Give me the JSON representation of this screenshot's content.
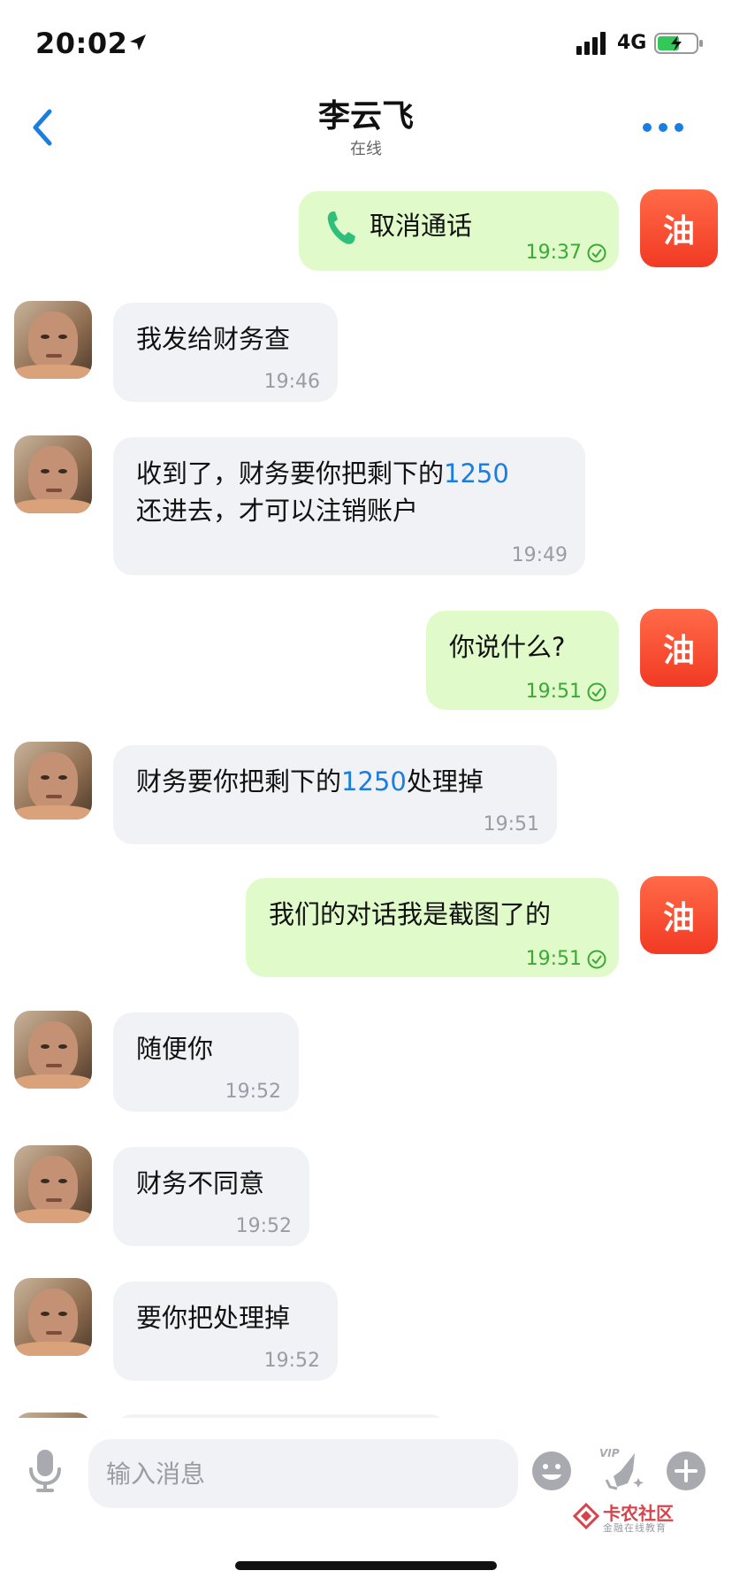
{
  "status_bar": {
    "time": "20:02",
    "network": "4G"
  },
  "header": {
    "title": "李云飞",
    "subtitle": "在线"
  },
  "messages": [
    {
      "dir": "out",
      "type": "call",
      "text": "取消通话",
      "time": "19:37"
    },
    {
      "dir": "in",
      "text": "我发给财务查",
      "time": "19:46"
    },
    {
      "dir": "in",
      "line1_pre": "收到了，财务要你把剩下的",
      "line1_num": "1250",
      "line2": "还进去，才可以注销账户",
      "time": "19:49"
    },
    {
      "dir": "out",
      "text": "你说什么?",
      "time": "19:51"
    },
    {
      "dir": "in",
      "pre": "财务要你把剩下的",
      "num": "1250",
      "post": "处理掉",
      "time": "19:51"
    },
    {
      "dir": "out",
      "text": "我们的对话我是截图了的",
      "time": "19:51"
    },
    {
      "dir": "in",
      "text": "随便你",
      "time": "19:52"
    },
    {
      "dir": "in",
      "text": "财务不同意",
      "time": "19:52"
    },
    {
      "dir": "in",
      "text": "要你把处理掉",
      "time": "19:52"
    }
  ],
  "my_avatar_text": "油",
  "input": {
    "placeholder": "输入消息"
  },
  "watermark": {
    "title": "卡农社区",
    "subtitle": "金融在线教育"
  },
  "colors": {
    "accent": "#1a7de0",
    "out_bubble": "#e0fbc9",
    "in_bubble": "#f1f2f6",
    "avatar_red": "#f23a24",
    "sent_time": "#3ba935"
  }
}
